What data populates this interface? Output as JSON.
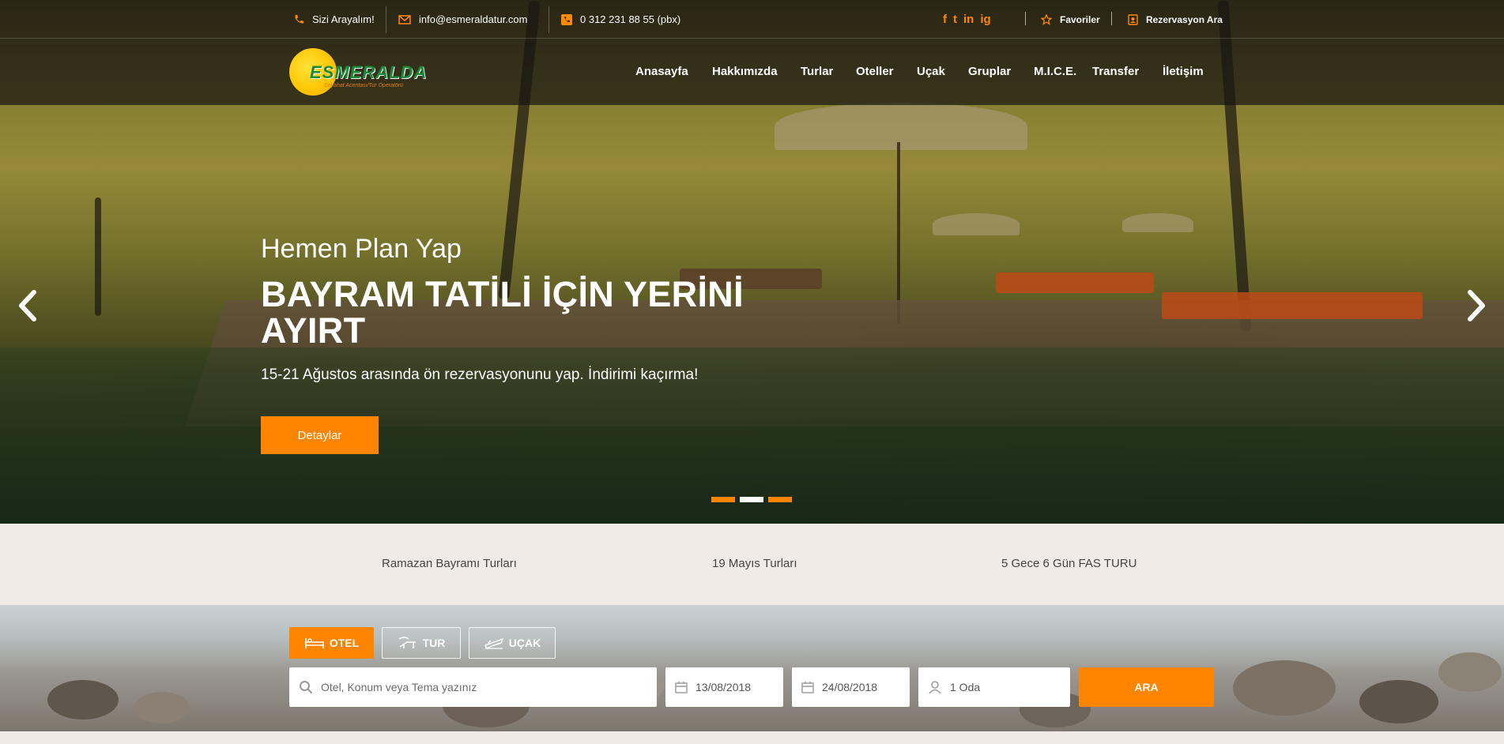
{
  "topbar": {
    "call_label": "Sizi Arayalım!",
    "email": "info@esmeraldatur.com",
    "phone": "0 312 231 88 55 (pbx)",
    "social": [
      "f",
      "t",
      "in",
      "ig"
    ],
    "favorites_label": "Favoriler",
    "reservation_label": "Rezervasyon Ara"
  },
  "logo": {
    "word": "ESMERALDA",
    "tagline": "Seyahat Acentası/Tur Operatörü"
  },
  "nav": {
    "items": [
      "Anasayfa",
      "Hakkımızda",
      "Turlar",
      "Oteller",
      "Uçak",
      "Gruplar",
      "M.I.C.E.",
      "Transfer",
      "İletişim"
    ]
  },
  "hero": {
    "subtitle": "Hemen Plan Yap",
    "title": "BAYRAM TATİLİ İÇİN YERİNİ AYIRT",
    "description": "15-21 Ağustos arasında ön rezervasyonunu yap. İndirimi kaçırma!",
    "button_label": "Detaylar",
    "active_slide": 2
  },
  "tours": {
    "links": [
      "Ramazan Bayramı Turları",
      "19 Mayıs Turları",
      "5 Gece 6 Gün FAS TURU"
    ]
  },
  "search": {
    "tabs": [
      "OTEL",
      "TUR",
      "UÇAK"
    ],
    "active_tab": "OTEL",
    "query_placeholder": "Otel, Konum veya Tema yazınız",
    "checkin": "13/08/2018",
    "checkout": "24/08/2018",
    "rooms": "1 Oda",
    "submit_label": "ARA"
  },
  "colors": {
    "accent": "#ff8400",
    "dark_overlay": "#19160f"
  }
}
